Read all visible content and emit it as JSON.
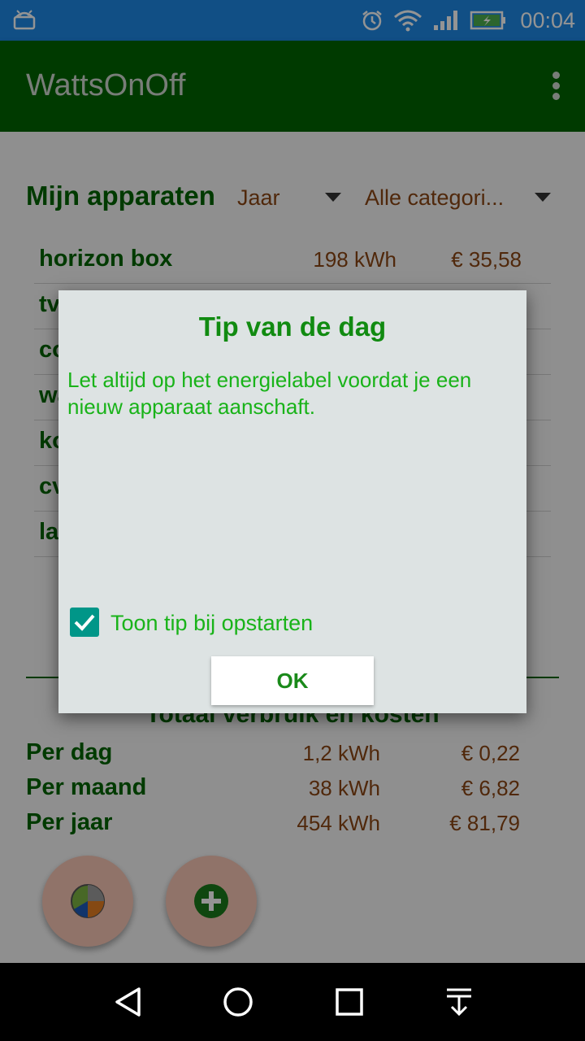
{
  "status_bar": {
    "time": "00:04",
    "icons": [
      "android-icon",
      "alarm-icon",
      "wifi-icon",
      "signal-icon",
      "battery-charging-icon"
    ]
  },
  "app_bar": {
    "title": "WattsOnOff",
    "overflow_icon": "more-vert-icon"
  },
  "main": {
    "header": "Mijn apparaten",
    "period_spinner": "Jaar",
    "category_spinner": "Alle categori...",
    "devices": [
      {
        "name": "horizon box",
        "kwh": "198 kWh",
        "cost": "€ 35,58"
      },
      {
        "name": "tv",
        "kwh": "",
        "cost": ""
      },
      {
        "name": "co",
        "kwh": "",
        "cost": ""
      },
      {
        "name": "wa",
        "kwh": "",
        "cost": ""
      },
      {
        "name": "ko",
        "kwh": "",
        "cost": ""
      },
      {
        "name": "cv",
        "kwh": "",
        "cost": ""
      },
      {
        "name": "la",
        "kwh": "",
        "cost": ""
      }
    ],
    "totals_title": "Totaal verbruik en kosten",
    "totals": [
      {
        "label": "Per dag",
        "kwh": "1,2 kWh",
        "cost": "€ 0,22"
      },
      {
        "label": "Per maand",
        "kwh": "38 kWh",
        "cost": "€ 6,82"
      },
      {
        "label": "Per jaar",
        "kwh": "454 kWh",
        "cost": "€ 81,79"
      }
    ],
    "fabs": [
      "pie-chart-icon",
      "add-icon"
    ]
  },
  "dialog": {
    "title": "Tip van de dag",
    "message": "Let altijd op het energielabel voordat je een nieuw apparaat aanschaft.",
    "checkbox_label": "Toon tip bij opstarten",
    "checkbox_checked": true,
    "ok_label": "OK"
  },
  "nav_bar": {
    "icons": [
      "back-icon",
      "home-icon",
      "recents-icon",
      "notifications-pull-icon"
    ]
  }
}
